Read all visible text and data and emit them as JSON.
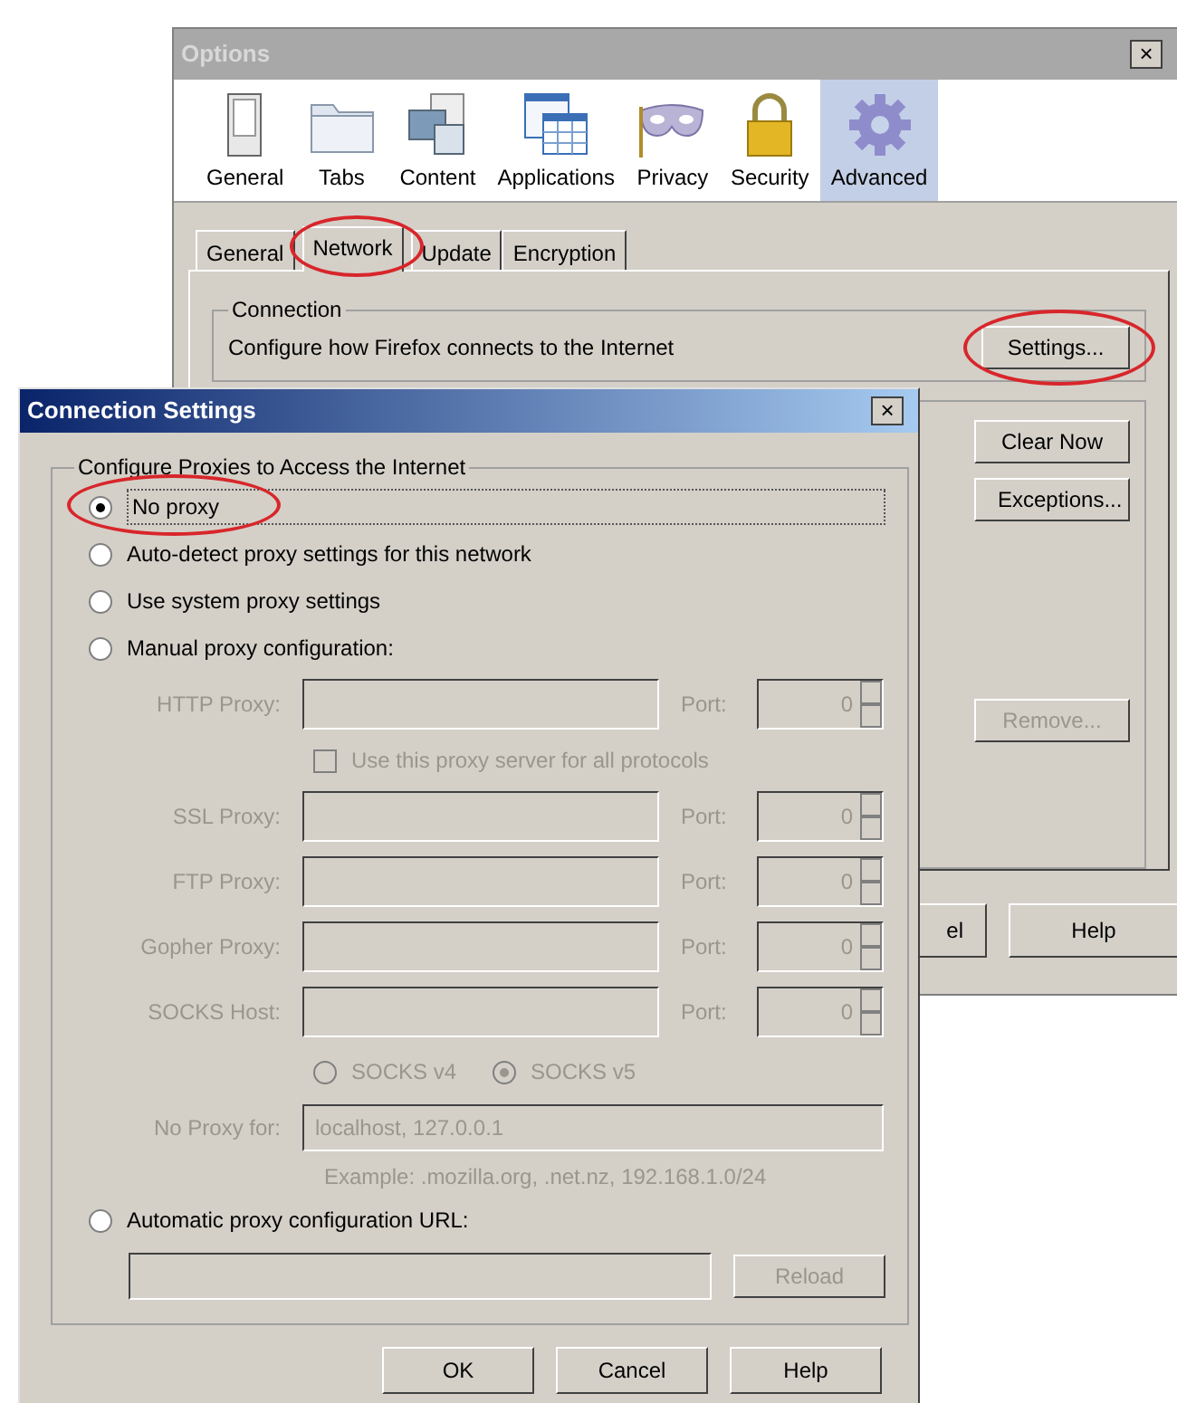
{
  "options_window": {
    "title": "Options",
    "close": "×",
    "toolbar": [
      {
        "label": "General",
        "kind": "switch",
        "selected": false
      },
      {
        "label": "Tabs",
        "kind": "folder",
        "selected": false
      },
      {
        "label": "Content",
        "kind": "content",
        "selected": false
      },
      {
        "label": "Applications",
        "kind": "applications",
        "selected": false
      },
      {
        "label": "Privacy",
        "kind": "mask",
        "selected": false
      },
      {
        "label": "Security",
        "kind": "lock",
        "selected": false
      },
      {
        "label": "Advanced",
        "kind": "gear",
        "selected": true
      }
    ],
    "tabs": [
      {
        "label": "General",
        "selected": false,
        "circled": false
      },
      {
        "label": "Network",
        "selected": true,
        "circled": true
      },
      {
        "label": "Update",
        "selected": false,
        "circled": false
      },
      {
        "label": "Encryption",
        "selected": false,
        "circled": false
      }
    ],
    "connection": {
      "legend": "Connection",
      "description": "Configure how Firefox connects to the Internet",
      "settings_button": {
        "label": "Settings...",
        "circled": true
      }
    },
    "side_buttons": [
      {
        "label": "Clear Now",
        "disabled": false
      },
      {
        "label": "Exceptions...",
        "disabled": false
      },
      {
        "label": "Remove...",
        "disabled": true
      }
    ],
    "footer_buttons": [
      "el",
      "Help"
    ]
  },
  "connection_dialog": {
    "title": "Connection Settings",
    "close": "×",
    "legend": "Configure Proxies to Access the Internet",
    "radios": [
      {
        "label": "No proxy",
        "selected": true,
        "circled": true
      },
      {
        "label": "Auto-detect proxy settings for this network",
        "selected": false,
        "circled": false
      },
      {
        "label": "Use system proxy settings",
        "selected": false,
        "circled": false
      },
      {
        "label": "Manual proxy configuration:",
        "selected": false,
        "circled": false
      },
      {
        "label": "Automatic proxy configuration URL:",
        "selected": false,
        "circled": false
      }
    ],
    "manual": {
      "disabled": true,
      "http": {
        "label": "HTTP Proxy:",
        "port_label": "Port:",
        "port": "0"
      },
      "share_checkbox": {
        "label": "Use this proxy server for all protocols",
        "checked": false
      },
      "proxies": [
        {
          "label": "SSL Proxy:",
          "port_label": "Port:",
          "port": "0"
        },
        {
          "label": "FTP Proxy:",
          "port_label": "Port:",
          "port": "0"
        },
        {
          "label": "Gopher Proxy:",
          "port_label": "Port:",
          "port": "0"
        },
        {
          "label": "SOCKS Host:",
          "port_label": "Port:",
          "port": "0"
        }
      ],
      "socks_versions": [
        {
          "label": "SOCKS v4",
          "selected": false
        },
        {
          "label": "SOCKS v5",
          "selected": true
        }
      ],
      "no_proxy": {
        "label": "No Proxy for:",
        "value": "localhost, 127.0.0.1"
      },
      "example": "Example: .mozilla.org, .net.nz, 192.168.1.0/24"
    },
    "auto_url": {
      "reload": {
        "label": "Reload",
        "disabled": true
      }
    },
    "buttons": [
      "OK",
      "Cancel",
      "Help"
    ]
  }
}
